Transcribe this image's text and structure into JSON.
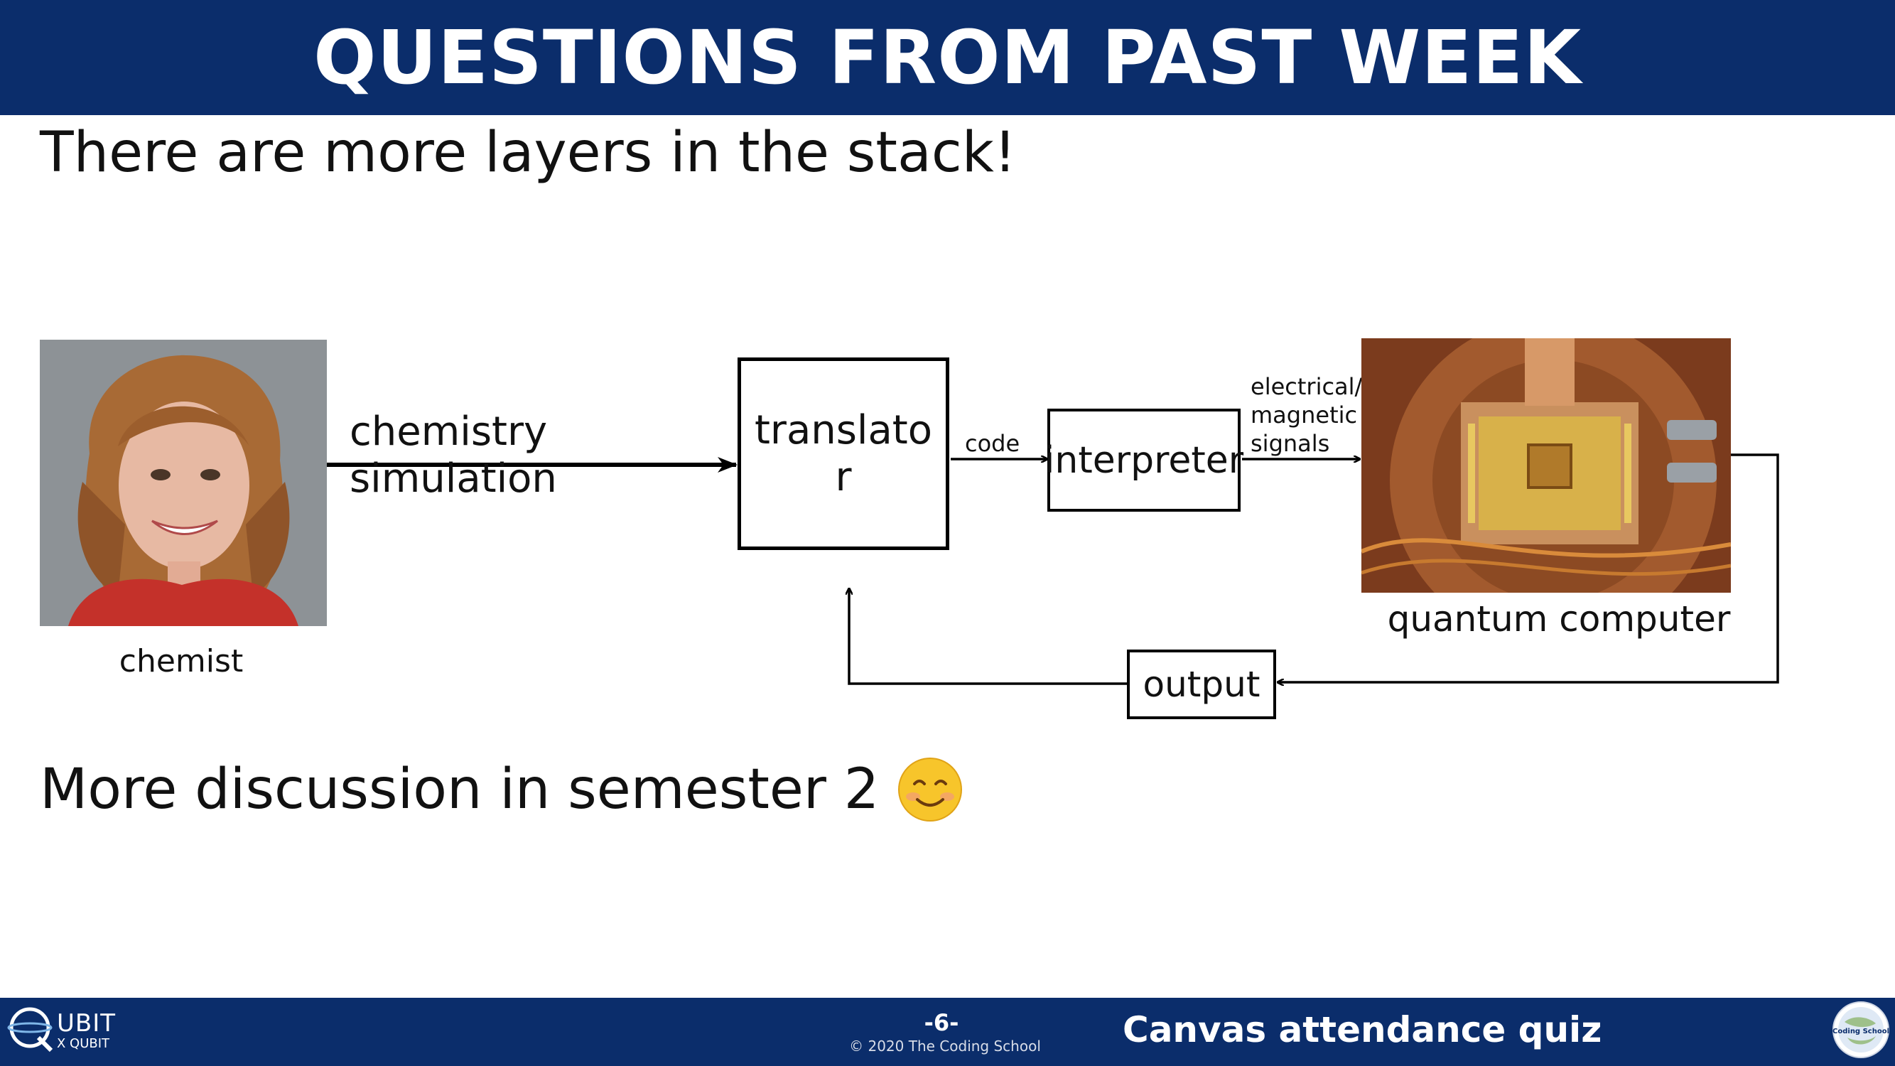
{
  "slide": {
    "title": "QUESTIONS FROM PAST WEEK",
    "subtitle": "There are more layers in the stack!",
    "closing": "More discussion in semester 2",
    "closing_emoji": "smiling-face-emoji"
  },
  "diagram": {
    "chemist_label": "chemist",
    "input_label": "chemistry\nsimulation",
    "translator_label": "translato\nr",
    "code_label": "code",
    "interpreter_label": "interpreter",
    "signals_label": "electrical/\nmagnetic\nsignals",
    "qc_label": "quantum computer",
    "output_label": "output"
  },
  "footer": {
    "page_number": "-6-",
    "copyright": "© 2020 The Coding School",
    "quiz_text": "Canvas attendance quiz",
    "logo_main": "UBIT",
    "logo_sub": "X QUBIT",
    "school_logo_text": "<Coding School>"
  },
  "colors": {
    "brand_navy": "#0b2d6b",
    "text": "#111111",
    "background": "#ffffff"
  }
}
